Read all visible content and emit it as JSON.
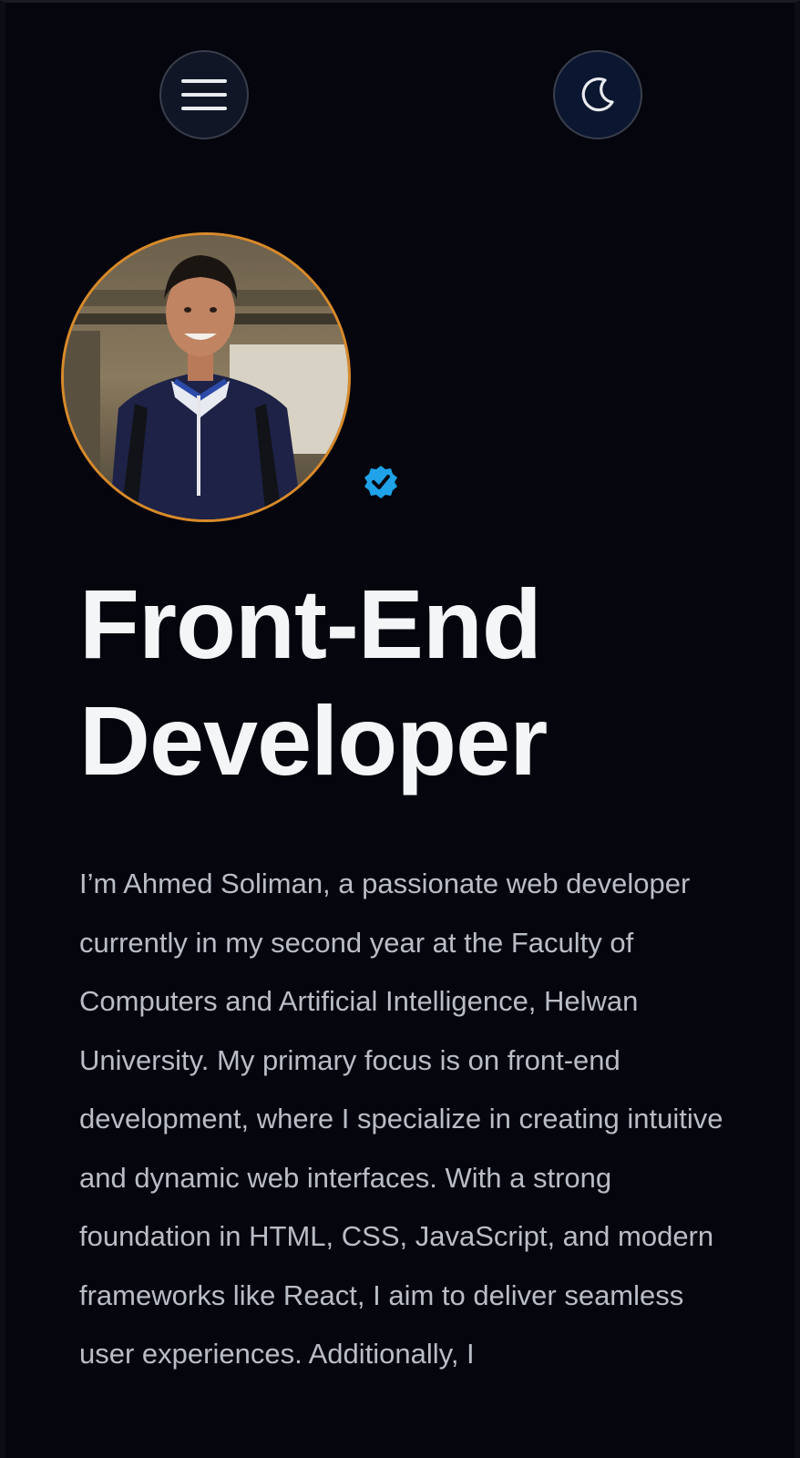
{
  "header": {
    "menu_icon": "hamburger-menu-icon",
    "theme_icon": "moon-icon"
  },
  "hero": {
    "avatar_alt": "profile-photo",
    "verified_icon": "verified-badge-icon",
    "headline": "Front-End Developer",
    "bio": "I’m Ahmed Soliman, a passionate web developer currently in my second year at the Faculty of Computers and Artificial Intelligence, Helwan University. My primary focus is on front-end development, where I specialize in creating intuitive and dynamic web interfaces. With a strong foundation in HTML, CSS, JavaScript, and modern frameworks like React, I aim to deliver seamless user experiences. Additionally, I"
  },
  "colors": {
    "background": "#04050d",
    "avatar_ring": "#d88a2a",
    "verified": "#1fa2e8",
    "headline": "#f4f5f7",
    "body_text": "#b9bdc6"
  }
}
